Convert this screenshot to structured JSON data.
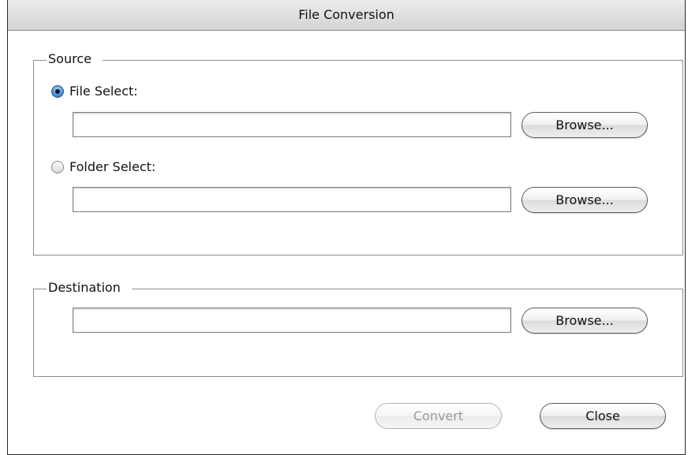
{
  "window": {
    "title": "File Conversion"
  },
  "source": {
    "legend": "Source",
    "file_select": {
      "label": "File Select:",
      "selected": true,
      "value": "",
      "browse_label": "Browse..."
    },
    "folder_select": {
      "label": "Folder Select:",
      "selected": false,
      "value": "",
      "browse_label": "Browse..."
    }
  },
  "destination": {
    "legend": "Destination",
    "value": "",
    "browse_label": "Browse..."
  },
  "footer": {
    "convert_label": "Convert",
    "convert_enabled": false,
    "close_label": "Close"
  }
}
